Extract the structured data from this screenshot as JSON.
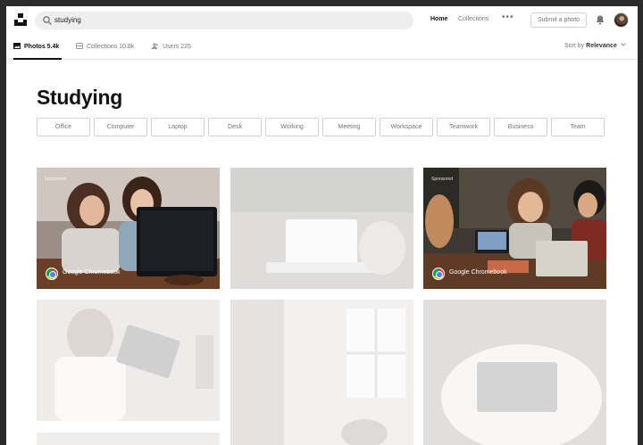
{
  "search": {
    "query": "studying"
  },
  "nav": {
    "home": "Home",
    "collections": "Collections",
    "more": "•••",
    "submit": "Submit a photo"
  },
  "tabs": [
    {
      "label": "Photos",
      "count": "5.4k",
      "text": "Photos 5.4k"
    },
    {
      "label": "Collections",
      "count": "10.8k",
      "text": "Collections 10.8k"
    },
    {
      "label": "Users",
      "count": "225",
      "text": "Users 225"
    }
  ],
  "sort": {
    "prefix": "Sort by",
    "value": "Relevance"
  },
  "page_title": "Studying",
  "related": [
    "Office",
    "Computer",
    "Laptop",
    "Desk",
    "Working",
    "Meeting",
    "Workspace",
    "Teamwork",
    "Business",
    "Team"
  ],
  "photos": {
    "p1": {
      "sponsored": "Sponsored",
      "brand": "Google Chromebook"
    },
    "p3": {
      "sponsored": "Sponsored",
      "brand": "Google Chromebook"
    }
  },
  "colors": {
    "text": "#111111",
    "muted": "#767676",
    "border": "#d1d1d1",
    "search_bg": "#eeeeee"
  },
  "icons": [
    "unsplash-logo-icon",
    "search-icon",
    "bell-icon",
    "photos-icon",
    "collections-icon",
    "users-icon",
    "chevron-down-icon",
    "chrome-icon"
  ]
}
